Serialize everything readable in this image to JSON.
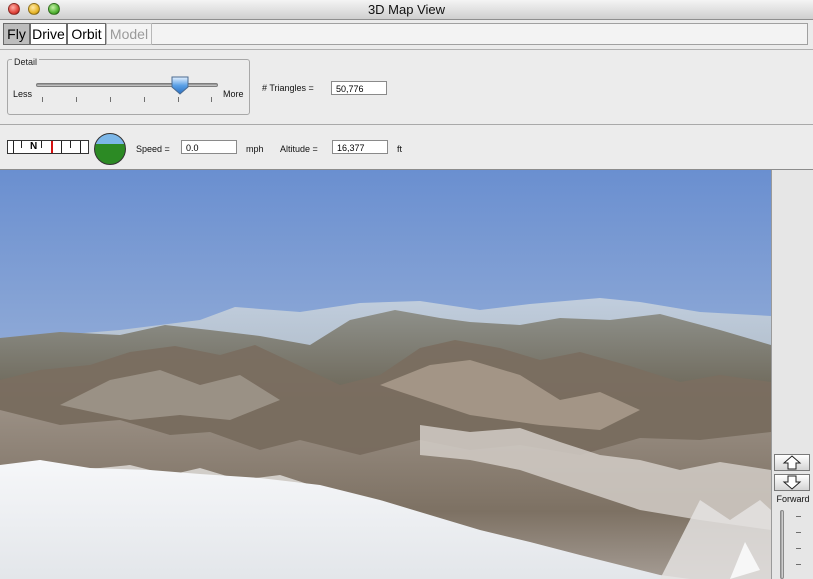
{
  "window": {
    "title": "3D Map View"
  },
  "modes": {
    "fly": "Fly",
    "drive": "Drive",
    "orbit": "Orbit",
    "model": "Model",
    "selected": "Fly"
  },
  "detail": {
    "group_label": "Detail",
    "less_label": "Less",
    "more_label": "More",
    "level": 0.79,
    "triangles_label": "# Triangles =",
    "triangles_value": "50,776"
  },
  "navigation": {
    "compass_letter": "N",
    "speed_label": "Speed =",
    "speed_value": "0.0",
    "speed_unit": "mph",
    "altitude_label": "Altitude =",
    "altitude_value": "16,377",
    "altitude_unit": "ft"
  },
  "movement": {
    "direction_label": "Forward"
  },
  "colors": {
    "sky_top": "#6a8fd0",
    "sky_horizon": "#bcc9da",
    "horizon_ground": "#2c8a24",
    "compass_needle": "#d41010"
  }
}
